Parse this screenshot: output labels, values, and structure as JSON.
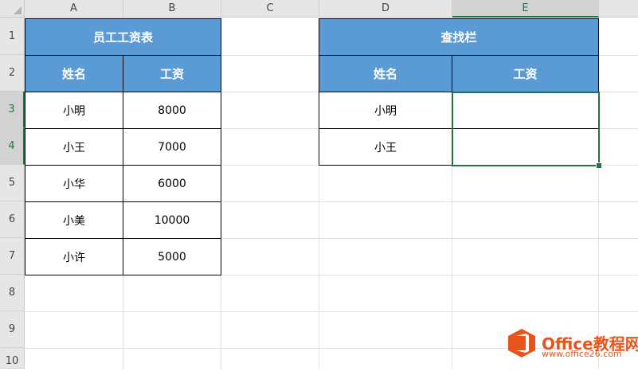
{
  "columns": [
    "A",
    "B",
    "C",
    "D",
    "E"
  ],
  "rows": [
    "1",
    "2",
    "3",
    "4",
    "5",
    "6",
    "7",
    "8",
    "9",
    "10"
  ],
  "employee_table": {
    "title": "员工工资表",
    "headers": [
      "姓名",
      "工资"
    ],
    "rows": [
      {
        "name": "小明",
        "salary": "8000"
      },
      {
        "name": "小王",
        "salary": "7000"
      },
      {
        "name": "小华",
        "salary": "6000"
      },
      {
        "name": "小美",
        "salary": "10000"
      },
      {
        "name": "小许",
        "salary": "5000"
      }
    ]
  },
  "lookup_table": {
    "title": "查找栏",
    "headers": [
      "姓名",
      "工资"
    ],
    "rows": [
      {
        "name": "小明",
        "salary": ""
      },
      {
        "name": "小王",
        "salary": ""
      }
    ]
  },
  "selection": {
    "range": "E3:E4",
    "accent": "#217346"
  },
  "colors": {
    "header_fill": "#5b9bd5",
    "selection": "#217346",
    "watermark": "#e8541a"
  },
  "watermark": {
    "brand": "Office教程网",
    "url": "www.office26.com"
  }
}
